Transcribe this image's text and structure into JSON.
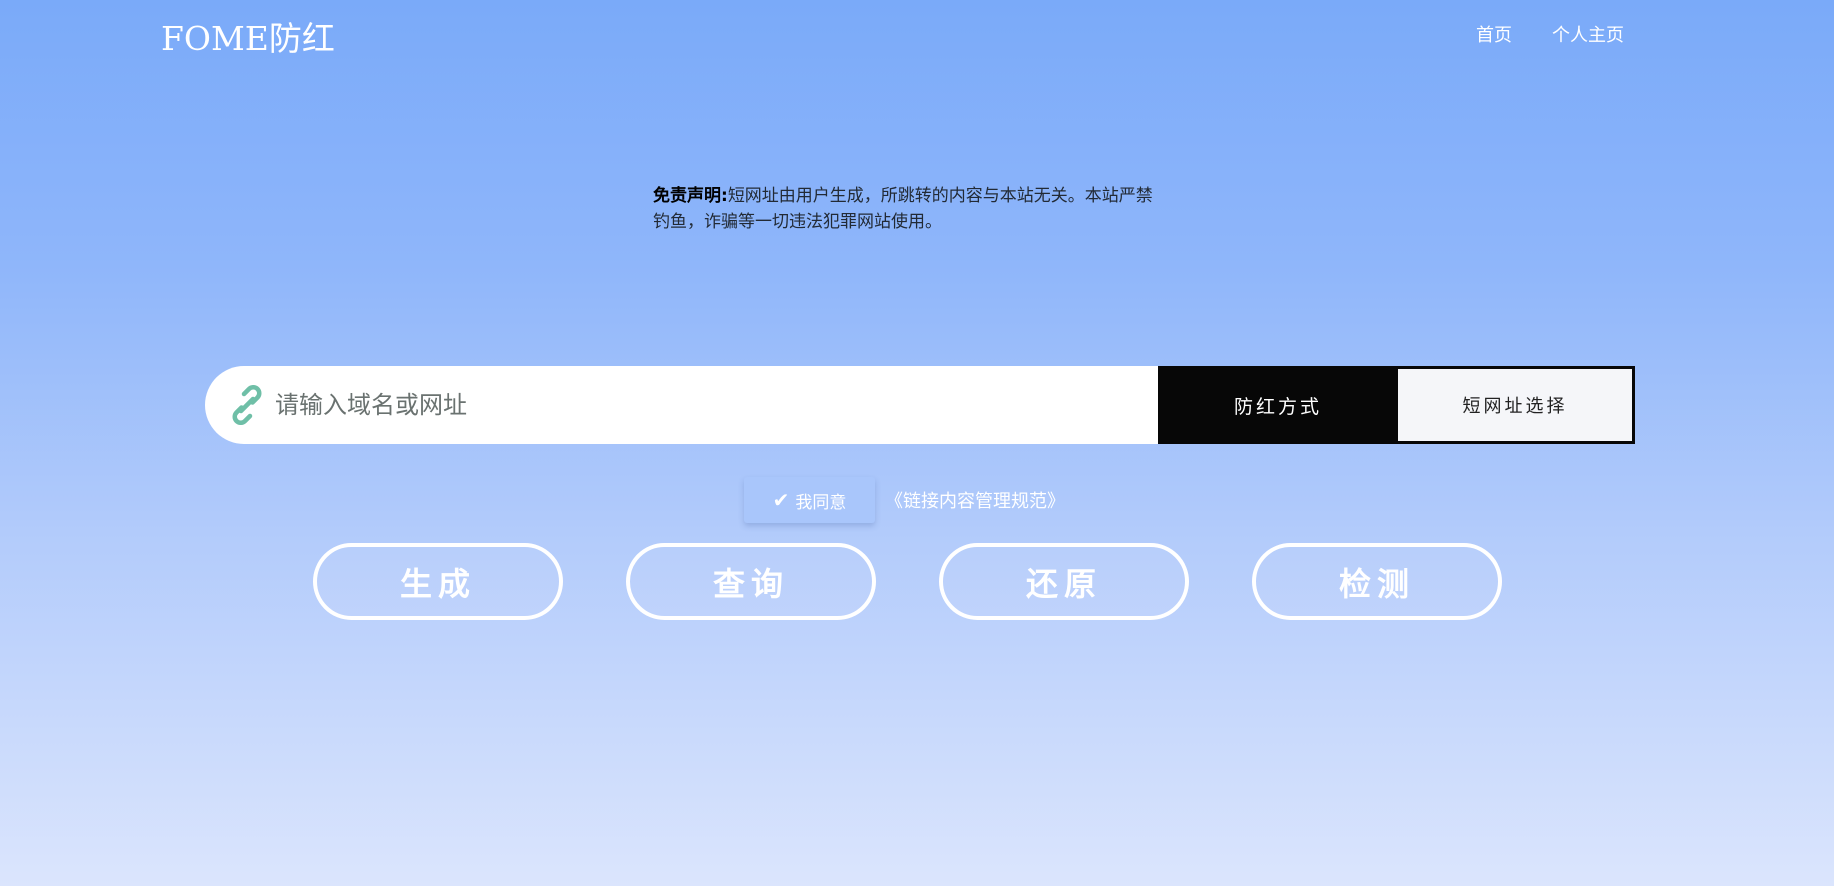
{
  "header": {
    "brand": "FOME防红",
    "nav": [
      {
        "label": "首页"
      },
      {
        "label": "个人主页"
      }
    ]
  },
  "disclaimer": {
    "title": "免责声明:",
    "text": "短网址由用户生成，所跳转的内容与本站无关。本站严禁钓鱼，诈骗等一切违法犯罪网站使用。"
  },
  "search": {
    "icon": "link-icon",
    "placeholder": "请输入域名或网址",
    "value": "",
    "mode_label": "防红方式",
    "short_label": "短网址选择"
  },
  "agree": {
    "icon": "check-icon",
    "label": "我同意",
    "policy": "《链接内容管理规范》"
  },
  "actions": [
    {
      "label": "生成"
    },
    {
      "label": "查询"
    },
    {
      "label": "还原"
    },
    {
      "label": "检测"
    }
  ],
  "colors": {
    "bg_top": "#7aaaf9",
    "bg_bottom": "#dbe5fd",
    "icon_accent": "#6fbfa7",
    "mode_bg": "#070707"
  }
}
